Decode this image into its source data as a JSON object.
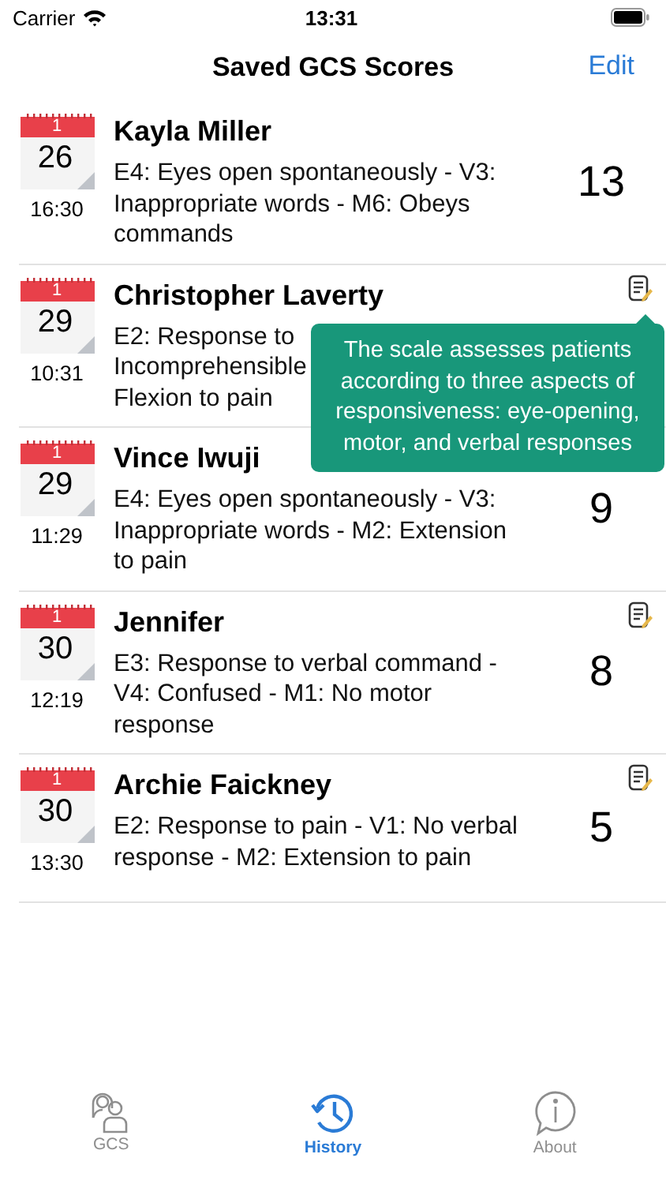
{
  "status_bar": {
    "carrier": "Carrier",
    "time": "13:31"
  },
  "nav": {
    "title": "Saved GCS Scores",
    "action": "Edit"
  },
  "rows": [
    {
      "month": "1",
      "day": "26",
      "time": "16:30",
      "name": "Kayla Miller",
      "lines": [
        "E4: Eyes open spontaneously - V3:",
        "Inappropriate words - M6: Obeys",
        "commands"
      ],
      "score": "13",
      "has_note": false
    },
    {
      "month": "1",
      "day": "29",
      "time": "10:31",
      "name": "Christopher Laverty",
      "lines": [
        "E2: Response to",
        "Incomprehensible",
        "Flexion to pain"
      ],
      "score": "",
      "has_note": true
    },
    {
      "month": "1",
      "day": "29",
      "time": "11:29",
      "name": "Vince Iwuji",
      "lines": [
        "E4: Eyes open spontaneously - V3:",
        "Inappropriate words - M2: Extension",
        "to pain"
      ],
      "score": "9",
      "has_note": false
    },
    {
      "month": "1",
      "day": "30",
      "time": "12:19",
      "name": "Jennifer",
      "lines": [
        "E3: Response to verbal command -",
        "V4: Confused - M1: No motor",
        "response"
      ],
      "score": "8",
      "has_note": true
    },
    {
      "month": "1",
      "day": "30",
      "time": "13:30",
      "name": "Archie Faickney",
      "lines": [
        "E2: Response to pain - V1: No verbal",
        "response - M2: Extension to pain"
      ],
      "score": "5",
      "has_note": true
    }
  ],
  "tooltip": {
    "text": "The scale assesses patients according to three aspects of responsiveness: eye-opening, motor, and verbal responses"
  },
  "tabs": [
    {
      "kind": "people",
      "label": "GCS",
      "selected": false
    },
    {
      "kind": "history",
      "label": "History",
      "selected": true
    },
    {
      "kind": "info",
      "label": "About",
      "selected": false
    }
  ]
}
